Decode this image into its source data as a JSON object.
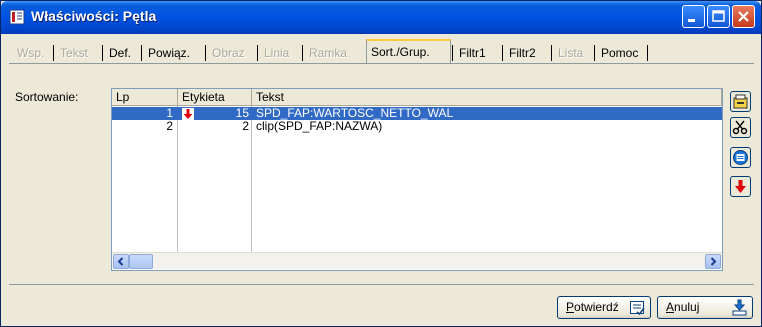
{
  "window": {
    "title": "Właściwości: Pętla",
    "controls": [
      "minimize",
      "maximize",
      "close"
    ]
  },
  "tabs": [
    {
      "label": "Wsp.",
      "state": "disabled"
    },
    {
      "label": "Tekst",
      "state": "disabled"
    },
    {
      "label": "Def.",
      "state": "enabled"
    },
    {
      "label": "Powiąz.",
      "state": "enabled"
    },
    {
      "label": "Obraz",
      "state": "disabled"
    },
    {
      "label": "Linia",
      "state": "disabled"
    },
    {
      "label": "Ramka",
      "state": "disabled"
    },
    {
      "label": "Sort./Grup.",
      "state": "active"
    },
    {
      "label": "Filtr1",
      "state": "enabled"
    },
    {
      "label": "Filtr2",
      "state": "enabled"
    },
    {
      "label": "Lista",
      "state": "disabled"
    },
    {
      "label": "Pomoc",
      "state": "enabled"
    }
  ],
  "sort": {
    "label": "Sortowanie:",
    "columns": [
      "Lp",
      "Etykieta",
      "Tekst"
    ],
    "rows": [
      {
        "lp": "1",
        "sort_direction": "descending",
        "etykieta": "15",
        "tekst": "SPD_FAP:WARTOSC_NETTO_WAL",
        "selected": true
      },
      {
        "lp": "2",
        "sort_direction": "",
        "etykieta": "2",
        "tekst": "clip(SPD_FAP:NAZWA)",
        "selected": false
      }
    ]
  },
  "side_buttons": [
    "add-icon",
    "cut-icon",
    "edit-icon",
    "sort-desc-icon"
  ],
  "buttons": {
    "confirm_prefix": "P",
    "confirm_rest": "otwierdź",
    "cancel_prefix": "A",
    "cancel_rest": "nuluj"
  },
  "colors": {
    "title_bar": "#0054e3",
    "selection": "#316ac5",
    "arrow_red": "#e0000c",
    "close_red": "#c3391d"
  }
}
